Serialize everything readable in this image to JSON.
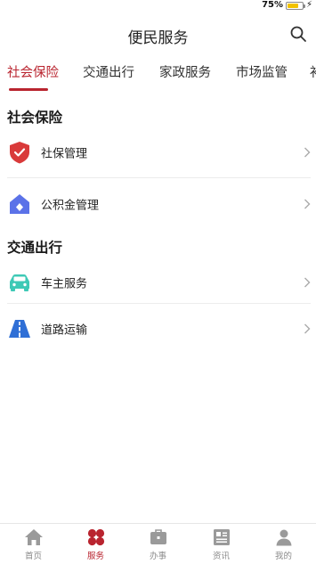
{
  "status": {
    "battery_percent": "75%",
    "battery_level": 0.75
  },
  "header": {
    "title": "便民服务"
  },
  "tabs": [
    {
      "label": "社会保险",
      "active": true
    },
    {
      "label": "交通出行",
      "active": false
    },
    {
      "label": "家政服务",
      "active": false
    },
    {
      "label": "市场监管",
      "active": false
    },
    {
      "label": "补",
      "active": false
    }
  ],
  "sections": [
    {
      "title": "社会保险",
      "items": [
        {
          "label": "社保管理",
          "icon": "shield-check-icon"
        },
        {
          "label": "公积金管理",
          "icon": "house-diamond-icon"
        }
      ]
    },
    {
      "title": "交通出行",
      "items": [
        {
          "label": "车主服务",
          "icon": "car-icon"
        },
        {
          "label": "道路运输",
          "icon": "road-icon"
        }
      ]
    }
  ],
  "bottom_nav": [
    {
      "label": "首页",
      "icon": "home-icon",
      "active": false
    },
    {
      "label": "服务",
      "icon": "services-icon",
      "active": true
    },
    {
      "label": "办事",
      "icon": "briefcase-icon",
      "active": false
    },
    {
      "label": "资讯",
      "icon": "news-icon",
      "active": false
    },
    {
      "label": "我的",
      "icon": "profile-icon",
      "active": false
    }
  ],
  "colors": {
    "accent": "#b9242f",
    "car_icon": "#3ec9b6",
    "road_icon": "#2f6fd6",
    "house_icon": "#5b72e8",
    "nav_inactive": "#9a9a9a"
  }
}
